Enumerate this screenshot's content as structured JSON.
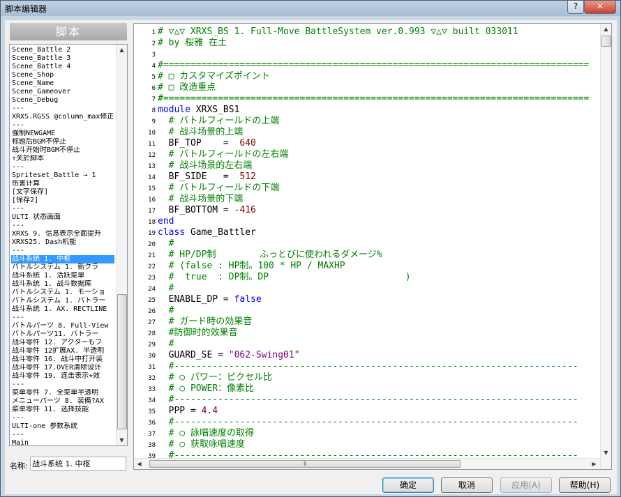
{
  "window": {
    "title": "脚本编辑器",
    "help_label": "?",
    "close_label": "✕"
  },
  "left_panel": {
    "header": "脚本"
  },
  "script_list": [
    "Scene_Battle 2",
    "Scene_Battle 3",
    "Scene_Battle 4",
    "Scene_Shop",
    "Scene_Name",
    "Scene_Gameover",
    "Scene_Debug",
    "---",
    "XRXS.RGSS @column_max修正",
    "---",
    "強制NEWGAME",
    "标题后BGM不停止",
    "战斗开始时BGM不停止",
    "  ↑关於脚本",
    "---",
    "Spriteset_Battle → 1",
    "伤害计算",
    "[文字保存]",
    "[保存2]",
    "---",
    "ULTI 状态画面",
    "---",
    "XRXS 9. 信息表示全面提升",
    "XRXS25. Dash机能",
    "---",
    "战斗系统 1. 中枢",
    "バトルシステム 1. 新クラ",
    "战斗系统 1. 活跃菜单",
    "战斗系统 1. 战斗数据库",
    "バトルシステム 1. モーショ",
    "バトルシステム 1. バトラー",
    "战斗系统 1. AX. RECTLINE",
    "---",
    "バトルパーツ 8. Full-View",
    "バトルパーツ11. バトラー",
    "战斗零件 12. アクターもフ",
    "战斗零件 12扩展AX. 半透明",
    "战斗零件 16. 战斗中打开装",
    "战斗零件 17.OVER清除设计",
    "战斗零件 19. 连击表示+效",
    "---",
    "菜单零件 7. 全菜单半透明",
    "メニューパーツ 8. 装備?AX",
    "菜单零件 11. 选择技能",
    "---",
    "ULTI-one 参数系统",
    "---",
    "Main"
  ],
  "name_field": {
    "label": "名称:",
    "value": "战斗系统 1. 中枢"
  },
  "code_lines": [
    {
      "n": 1,
      "tokens": [
        {
          "t": "# ▽△▽ XRXS_BS 1. Full-Move BattleSystem ver.0.993 ▽△▽ built 033011",
          "c": "comment"
        }
      ]
    },
    {
      "n": 2,
      "tokens": [
        {
          "t": "# by 桜雅 在土",
          "c": "comment"
        }
      ]
    },
    {
      "n": 3,
      "tokens": []
    },
    {
      "n": 4,
      "tokens": [
        {
          "t": "#==============================================================================",
          "c": "comment"
        }
      ]
    },
    {
      "n": 5,
      "tokens": [
        {
          "t": "# □ カスタマイズポイント",
          "c": "comment"
        }
      ]
    },
    {
      "n": 6,
      "tokens": [
        {
          "t": "# □ 改造重点",
          "c": "comment"
        }
      ]
    },
    {
      "n": 7,
      "tokens": [
        {
          "t": "#==============================================================================",
          "c": "comment"
        }
      ]
    },
    {
      "n": 8,
      "tokens": [
        {
          "t": "module",
          "c": "keyword"
        },
        {
          "t": " XRXS_BS1",
          "c": "text"
        }
      ]
    },
    {
      "n": 9,
      "tokens": [
        {
          "t": "  # バトルフィールドの上端",
          "c": "comment"
        }
      ]
    },
    {
      "n": 10,
      "tokens": [
        {
          "t": "  # 战斗场景的上端",
          "c": "comment"
        }
      ]
    },
    {
      "n": 11,
      "tokens": [
        {
          "t": "  BF_TOP    =  ",
          "c": "text"
        },
        {
          "t": "640",
          "c": "number"
        }
      ]
    },
    {
      "n": 12,
      "tokens": [
        {
          "t": "  # バトルフィールドの左右端",
          "c": "comment"
        }
      ]
    },
    {
      "n": 13,
      "tokens": [
        {
          "t": "  # 战斗场景的左右端",
          "c": "comment"
        }
      ]
    },
    {
      "n": 14,
      "tokens": [
        {
          "t": "  BF_SIDE   =  ",
          "c": "text"
        },
        {
          "t": "512",
          "c": "number"
        }
      ]
    },
    {
      "n": 15,
      "tokens": [
        {
          "t": "  # バトルフィールドの下端",
          "c": "comment"
        }
      ]
    },
    {
      "n": 16,
      "tokens": [
        {
          "t": "  # 战斗场景的下端",
          "c": "comment"
        }
      ]
    },
    {
      "n": 17,
      "tokens": [
        {
          "t": "  BF_BOTTOM = ",
          "c": "text"
        },
        {
          "t": "-416",
          "c": "number"
        }
      ]
    },
    {
      "n": 18,
      "tokens": [
        {
          "t": "end",
          "c": "keyword"
        }
      ]
    },
    {
      "n": 19,
      "tokens": [
        {
          "t": "class",
          "c": "keyword"
        },
        {
          "t": " Game_Battler",
          "c": "text"
        }
      ]
    },
    {
      "n": 20,
      "tokens": [
        {
          "t": "  #",
          "c": "comment"
        }
      ]
    },
    {
      "n": 21,
      "tokens": [
        {
          "t": "  # HP/DP制        ふっとびに使われるダメージ%",
          "c": "comment"
        }
      ]
    },
    {
      "n": 22,
      "tokens": [
        {
          "t": "  # (false : HP制。100 * HP / MAXHP",
          "c": "comment"
        }
      ]
    },
    {
      "n": 23,
      "tokens": [
        {
          "t": "  #  true  : DP制。DP                         )",
          "c": "comment"
        }
      ]
    },
    {
      "n": 24,
      "tokens": [
        {
          "t": "  #",
          "c": "comment"
        }
      ]
    },
    {
      "n": 25,
      "tokens": [
        {
          "t": "  ENABLE_DP = ",
          "c": "text"
        },
        {
          "t": "false",
          "c": "keyword"
        }
      ]
    },
    {
      "n": 26,
      "tokens": [
        {
          "t": "  #",
          "c": "comment"
        }
      ]
    },
    {
      "n": 27,
      "tokens": [
        {
          "t": "  # ガード時の効果音",
          "c": "comment"
        }
      ]
    },
    {
      "n": 28,
      "tokens": [
        {
          "t": "  #防御时的效果音",
          "c": "comment"
        }
      ]
    },
    {
      "n": 29,
      "tokens": [
        {
          "t": "  #",
          "c": "comment"
        }
      ]
    },
    {
      "n": 30,
      "tokens": [
        {
          "t": "  GUARD_SE = ",
          "c": "text"
        },
        {
          "t": "\"062-Swing01\"",
          "c": "string"
        }
      ]
    },
    {
      "n": 31,
      "tokens": [
        {
          "t": "  #--------------------------------------------------------------------------",
          "c": "comment"
        }
      ]
    },
    {
      "n": 32,
      "tokens": [
        {
          "t": "  # ○ パワー：ピクセル比",
          "c": "comment"
        }
      ]
    },
    {
      "n": 33,
      "tokens": [
        {
          "t": "  # ○ POWER：像素比",
          "c": "comment"
        }
      ]
    },
    {
      "n": 34,
      "tokens": [
        {
          "t": "  #--------------------------------------------------------------------------",
          "c": "comment"
        }
      ]
    },
    {
      "n": 35,
      "tokens": [
        {
          "t": "  PPP = ",
          "c": "text"
        },
        {
          "t": "4.4",
          "c": "number"
        }
      ]
    },
    {
      "n": 36,
      "tokens": [
        {
          "t": "  #--------------------------------------------------------------------------",
          "c": "comment"
        }
      ]
    },
    {
      "n": 37,
      "tokens": [
        {
          "t": "  # ○ 詠唱速度の取得",
          "c": "comment"
        }
      ]
    },
    {
      "n": 38,
      "tokens": [
        {
          "t": "  # ○ 获取咏唱速度",
          "c": "comment"
        }
      ]
    },
    {
      "n": 39,
      "tokens": [
        {
          "t": "  #--------------------------------------------------------------------------",
          "c": "comment"
        }
      ]
    }
  ],
  "buttons": {
    "ok": "确定",
    "cancel": "取消",
    "apply": "应用(A)",
    "help": "帮助(H)"
  },
  "colors": {
    "comment": "#008000",
    "keyword": "#0000ff",
    "number": "#800000",
    "string": "#800080",
    "selection": "#3399ff"
  }
}
